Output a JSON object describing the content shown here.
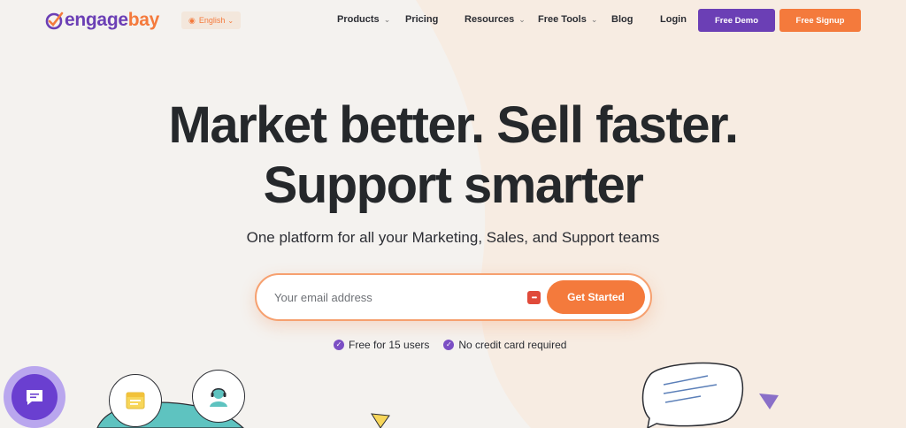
{
  "brand": {
    "engage": "engage",
    "bay": "bay",
    "purple": "#6b3fb5",
    "orange": "#f47a3c"
  },
  "language": {
    "label": "English",
    "icon": "globe-icon"
  },
  "nav": {
    "products": "Products",
    "pricing": "Pricing",
    "resources": "Resources",
    "free_tools": "Free Tools",
    "blog": "Blog",
    "login": "Login",
    "free_demo": "Free Demo",
    "free_signup": "Free Signup"
  },
  "hero": {
    "headline_line1": "Market better. Sell faster.",
    "headline_line2": "Support smarter",
    "subheadline": "One platform for all your Marketing, Sales, and Support teams",
    "email_placeholder": "Your email address",
    "cta": "Get Started",
    "perks": [
      "Free for 15 users",
      "No credit card required"
    ]
  }
}
